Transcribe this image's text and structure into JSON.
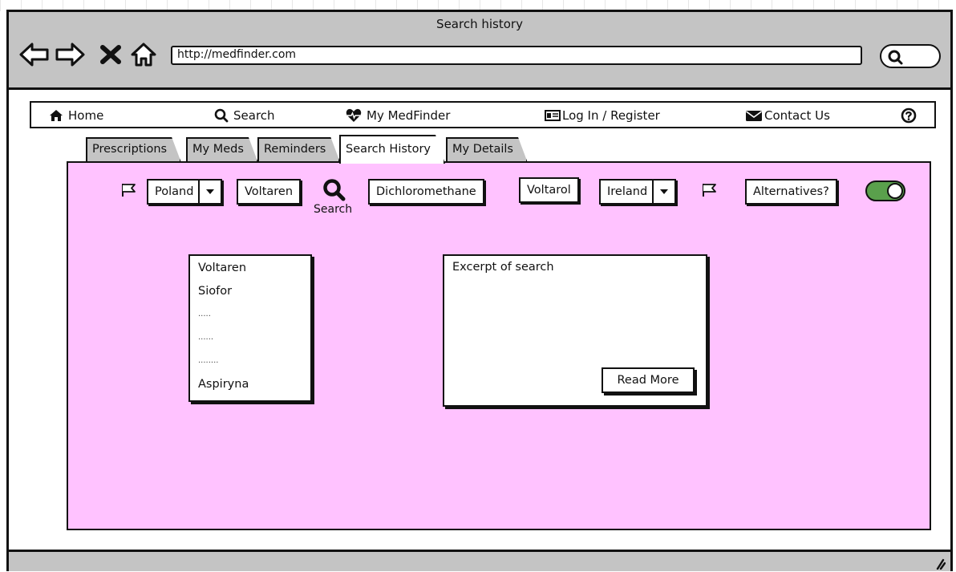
{
  "window": {
    "title": "Search history"
  },
  "browser": {
    "url": "http://medfinder.com",
    "icons": [
      "back-arrow-icon",
      "forward-arrow-icon",
      "stop-x-icon",
      "home-outline-icon",
      "search-icon"
    ]
  },
  "menu": {
    "items": [
      {
        "label": "Home",
        "icon": "home-icon"
      },
      {
        "label": "Search",
        "icon": "search-icon"
      },
      {
        "label": "My MedFinder",
        "icon": "heartbeat-icon"
      },
      {
        "label": "Log In / Register",
        "icon": "id-card-icon"
      },
      {
        "label": "Contact Us",
        "icon": "envelope-icon"
      }
    ],
    "help_icon": "help-circle-icon"
  },
  "tabs": [
    {
      "label": "Prescriptions",
      "active": false
    },
    {
      "label": "My Meds",
      "active": false
    },
    {
      "label": "Reminders",
      "active": false
    },
    {
      "label": "Search History",
      "active": true
    },
    {
      "label": "My Details",
      "active": false
    }
  ],
  "search_bar": {
    "from_country": "Poland",
    "from_drug": "Voltaren",
    "search_label": "Search",
    "active_ingredient": "Dichloromethane",
    "to_drug": "Voltarol",
    "to_country": "Ireland",
    "alternatives_label": "Alternatives?",
    "alternatives_on": true
  },
  "history_list": {
    "items": [
      "Voltaren",
      "Siofor",
      ".....",
      "......",
      "........",
      "Aspiryna"
    ]
  },
  "excerpt": {
    "text": "Excerpt of search",
    "read_more_label": "Read More"
  },
  "colors": {
    "content_bg": "#ffc2ff",
    "chrome_gray": "#c4c4c4",
    "toggle_on": "#5aa04c"
  }
}
